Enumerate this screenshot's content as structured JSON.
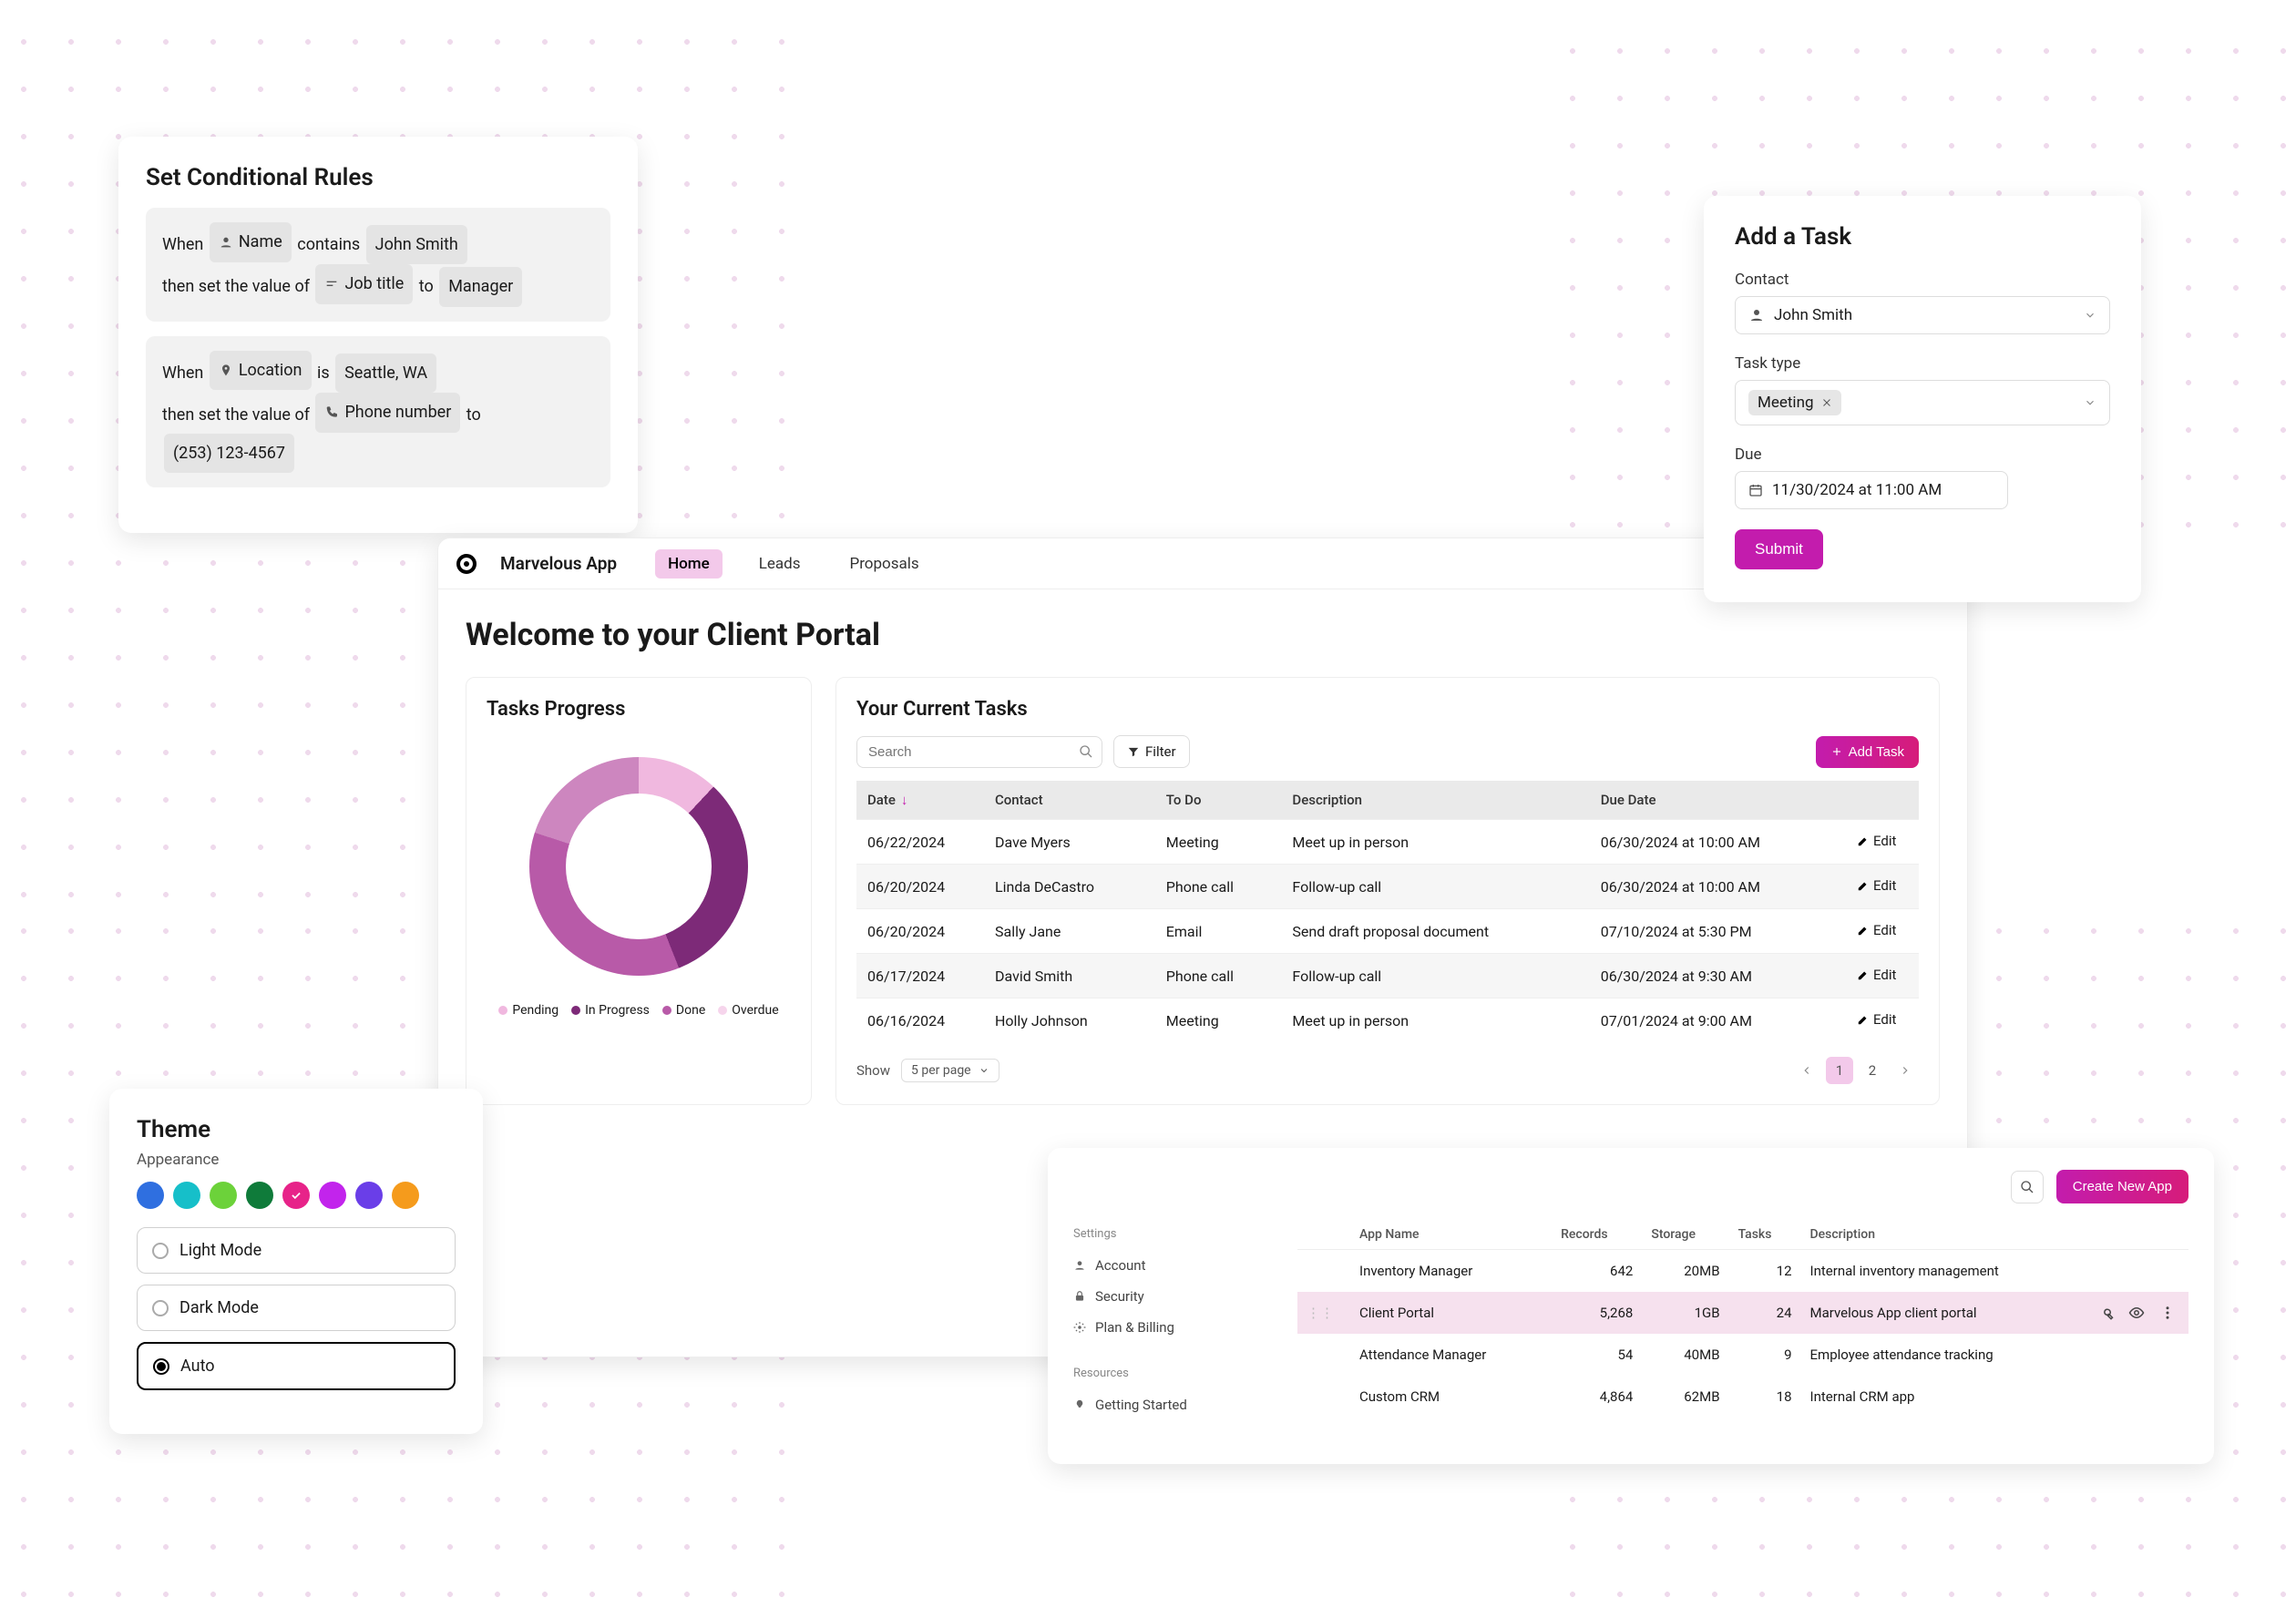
{
  "conditional": {
    "title": "Set Conditional Rules",
    "rule1": {
      "when": "When",
      "field1": "Name",
      "op": "contains",
      "val1": "John Smith",
      "then": "then set the value of",
      "field2": "Job title",
      "to": "to",
      "val2": "Manager"
    },
    "rule2": {
      "when": "When",
      "field1": "Location",
      "op": "is",
      "val1": "Seattle, WA",
      "then": "then set the value of",
      "field2": "Phone number",
      "to": "to",
      "val2": "(253) 123-4567"
    }
  },
  "theme": {
    "title": "Theme",
    "subtitle": "Appearance",
    "swatches": [
      "#2f6fe0",
      "#16bfc9",
      "#6cd23a",
      "#0f7b3a",
      "#e72389",
      "#c224ec",
      "#6a3ee8",
      "#f59b1c"
    ],
    "selected_swatch_index": 4,
    "modes": {
      "light": "Light Mode",
      "dark": "Dark Mode",
      "auto": "Auto"
    },
    "selected_mode": "auto"
  },
  "portal": {
    "brand": "Marvelous App",
    "nav": {
      "home": "Home",
      "leads": "Leads",
      "proposals": "Proposals"
    },
    "heading": "Welcome to your Client Portal",
    "progress": {
      "title": "Tasks Progress",
      "legend": {
        "pending": "Pending",
        "in_progress": "In Progress",
        "done": "Done",
        "overdue": "Overdue"
      }
    },
    "tasks": {
      "title": "Your Current Tasks",
      "search_placeholder": "Search",
      "filter": "Filter",
      "add": "Add Task",
      "columns": {
        "date": "Date",
        "contact": "Contact",
        "todo": "To Do",
        "desc": "Description",
        "due": "Due Date"
      },
      "edit": "Edit",
      "rows": [
        {
          "date": "06/22/2024",
          "contact": "Dave Myers",
          "todo": "Meeting",
          "desc": "Meet up in person",
          "due": "06/30/2024 at 10:00 AM"
        },
        {
          "date": "06/20/2024",
          "contact": "Linda DeCastro",
          "todo": "Phone call",
          "desc": "Follow-up call",
          "due": "06/30/2024 at 10:00 AM"
        },
        {
          "date": "06/20/2024",
          "contact": "Sally Jane",
          "todo": "Email",
          "desc": "Send draft proposal document",
          "due": "07/10/2024 at 5:30 PM"
        },
        {
          "date": "06/17/2024",
          "contact": "David Smith",
          "todo": "Phone call",
          "desc": "Follow-up call",
          "due": "06/30/2024 at 9:30 AM"
        },
        {
          "date": "06/16/2024",
          "contact": "Holly Johnson",
          "todo": "Meeting",
          "desc": "Meet up in person",
          "due": "07/01/2024 at 9:00 AM"
        }
      ],
      "footer": {
        "show": "Show",
        "per_page": "5 per page",
        "page1": "1",
        "page2": "2"
      }
    }
  },
  "addtask": {
    "title": "Add a Task",
    "contact_label": "Contact",
    "contact_value": "John Smith",
    "type_label": "Task type",
    "type_value": "Meeting",
    "due_label": "Due",
    "due_value": "11/30/2024 at 11:00 AM",
    "submit": "Submit"
  },
  "apps": {
    "search": "",
    "create": "Create New App",
    "side": {
      "settings": "Settings",
      "account": "Account",
      "security": "Security",
      "plan": "Plan & Billing",
      "resources": "Resources",
      "getting_started": "Getting Started"
    },
    "columns": {
      "name": "App Name",
      "records": "Records",
      "storage": "Storage",
      "tasks": "Tasks",
      "desc": "Description"
    },
    "rows": [
      {
        "name": "Inventory Manager",
        "records": "642",
        "storage": "20MB",
        "tasks": "12",
        "desc": "Internal inventory management"
      },
      {
        "name": "Client Portal",
        "records": "5,268",
        "storage": "1GB",
        "tasks": "24",
        "desc": "Marvelous App client portal"
      },
      {
        "name": "Attendance Manager",
        "records": "54",
        "storage": "40MB",
        "tasks": "9",
        "desc": "Employee attendance tracking"
      },
      {
        "name": "Custom CRM",
        "records": "4,864",
        "storage": "62MB",
        "tasks": "18",
        "desc": "Internal CRM app"
      }
    ],
    "selected_row_index": 1
  },
  "chart_data": {
    "type": "donut",
    "title": "Tasks Progress",
    "series": [
      {
        "name": "Pending",
        "value": 12,
        "color": "#f0b8df"
      },
      {
        "name": "In Progress",
        "value": 32,
        "color": "#7d2a78"
      },
      {
        "name": "Done",
        "value": 36,
        "color": "#b85aa8"
      },
      {
        "name": "Overdue",
        "value": 20,
        "color": "#cd86bf"
      }
    ],
    "note": "Values are estimates read from slice proportions; chart has no numeric labels."
  }
}
